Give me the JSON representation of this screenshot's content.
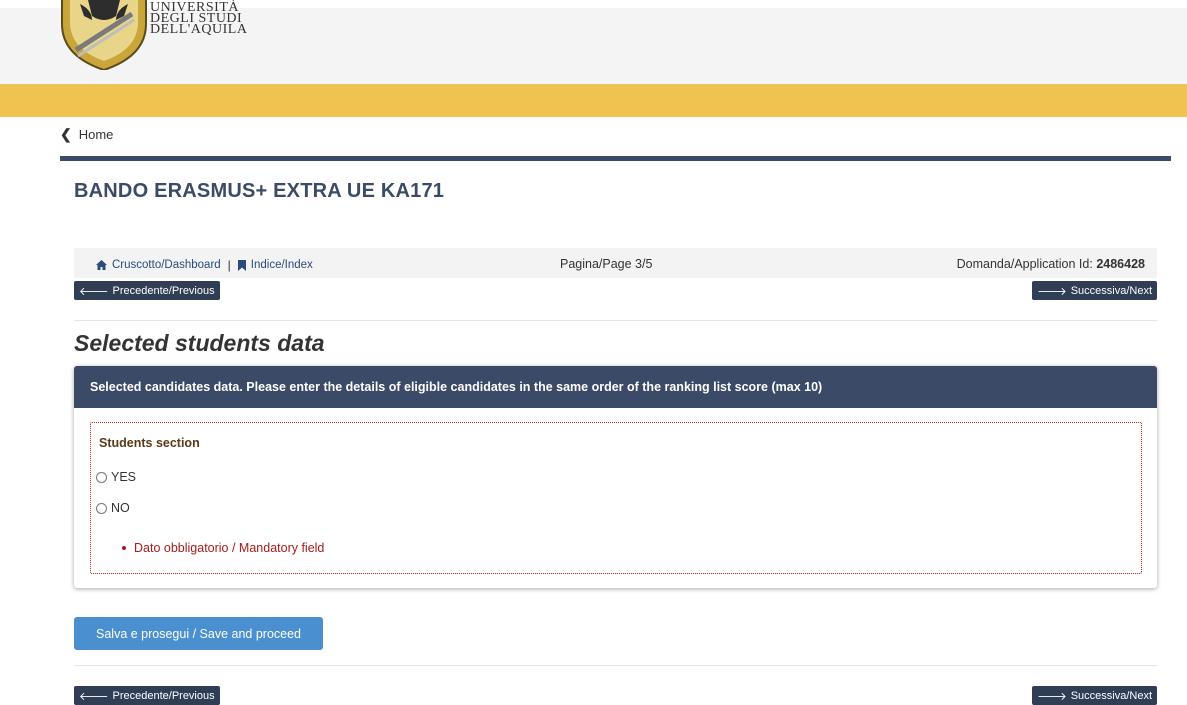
{
  "header": {
    "logo_lines": [
      "UNIVERSITÀ",
      "DEGLI STUDI",
      "DELL'AQUILA"
    ]
  },
  "breadcrumb": {
    "home_label": "Home"
  },
  "page": {
    "title": "BANDO ERASMUS+ EXTRA UE KA171"
  },
  "navbar": {
    "dashboard_label": "Cruscotto/Dashboard",
    "separator": "|",
    "index_label": "Indice/Index",
    "page_indicator": "Pagina/Page 3/5",
    "application_label": "Domanda/Application Id:",
    "application_id": "2486428"
  },
  "pager": {
    "previous_label": "Precedente/Previous",
    "next_label": "Successiva/Next"
  },
  "section": {
    "heading": "Selected students data",
    "panel_title": "Selected candidates data. Please enter the details of eligible candidates in the same order of the ranking list score (max 10)",
    "students_label": "Students section",
    "options": [
      "YES",
      "NO"
    ],
    "error": "Dato obbligatorio / Mandatory field"
  },
  "actions": {
    "save_label": "Salva e prosegui / Save and proceed"
  },
  "colors": {
    "accent_yellow": "#f0c24f",
    "navy": "#3b4a66",
    "button_dark": "#2f3d55",
    "save_blue": "#4a8fd0",
    "error_red": "#a61c1c"
  }
}
